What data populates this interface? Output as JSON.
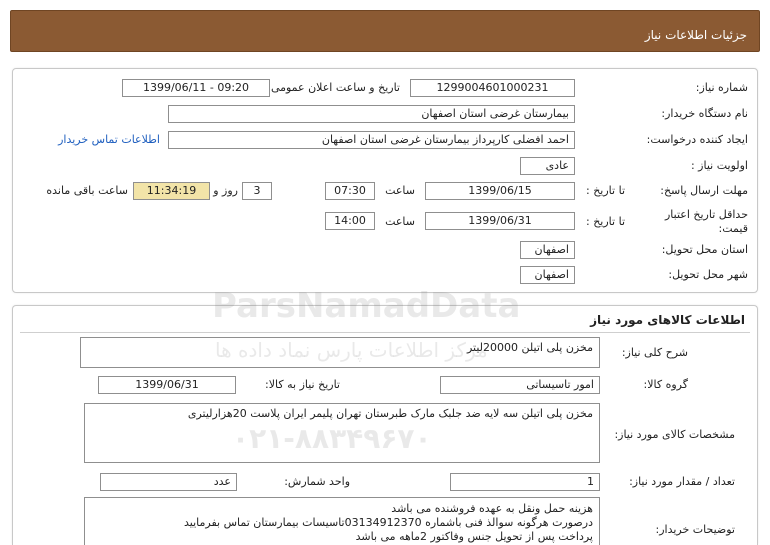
{
  "header": {
    "title": "جزئیات اطلاعات نیاز"
  },
  "need_info": {
    "need_number": {
      "label": "شماره نیاز:",
      "value": "1299004601000231"
    },
    "announce_datetime": {
      "label": "تاریخ و ساعت اعلان عمومی:",
      "value": "1399/06/11 - 09:20"
    },
    "buyer_org": {
      "label": "نام دستگاه خریدار:",
      "value": "بیمارستان غرضی استان اصفهان"
    },
    "requester": {
      "label": "ایجاد کننده درخواست:",
      "value": "احمد افضلی کارپرداز بیمارستان غرضی استان اصفهان"
    },
    "buyer_contact_link": "اطلاعات تماس خریدار",
    "priority": {
      "label": "اولویت نیاز :",
      "value": "عادی"
    },
    "response_deadline": {
      "label": "مهلت ارسال پاسخ:",
      "to_date_label": "تا تاریخ :",
      "date": "1399/06/15",
      "time_label": "ساعت",
      "time": "07:30",
      "days_left": "3",
      "days_label": "روز و",
      "time_left": "11:34:19",
      "time_left_label": "ساعت باقی مانده"
    },
    "price_validity": {
      "label_line1": "حداقل تاریخ اعتبار",
      "label_line2": "قیمت:",
      "to_date_label": "تا تاریخ :",
      "date": "1399/06/31",
      "time_label": "ساعت",
      "time": "14:00"
    },
    "delivery_province": {
      "label": "استان محل تحویل:",
      "value": "اصفهان"
    },
    "delivery_city": {
      "label": "شهر محل تحویل:",
      "value": "اصفهان"
    }
  },
  "goods_info": {
    "title": "اطلاعات کالاهای مورد نیاز",
    "general_description": {
      "label": "شرح کلی نیاز:",
      "value": "مخزن پلی اتیلن 20000لیتر"
    },
    "goods_group": {
      "label": "گروه کالا:",
      "value": "امور تاسیساتی"
    },
    "need_date": {
      "label": "تاریخ نیاز به کالا:",
      "value": "1399/06/31"
    },
    "specifications": {
      "label": "مشخصات کالای مورد نیاز:",
      "value": "مخزن پلی اتیلن سه لایه ضد جلبک مارک طبرستان تهران پلیمر ایران پلاست 20هزارلیتری"
    },
    "quantity": {
      "label": "تعداد / مقدار مورد نیاز:",
      "value": "1"
    },
    "unit": {
      "label": "واحد شمارش:",
      "value": "عدد"
    },
    "buyer_notes": {
      "label": "توضیحات خریدار:",
      "lines": [
        "هزینه حمل ونقل به عهده فروشنده می باشد",
        "درصورت هرگونه سوالذ فنی باشماره 03134912370تاسیسات بیمارستان تماس بفرمایید",
        "پرداخت پس از تحویل جنس وفاکتور 2ماهه می باشد"
      ]
    }
  },
  "watermark": {
    "brand": "ParsNamadData",
    "tagline": "مرکز اطلاعات پارس نماد داده ها",
    "phone": "۰۲۱-۸۸۳۴۹۶۷۰"
  },
  "colors": {
    "header_bg": "#8b5a33",
    "link": "#1f5fbf",
    "countdown_bg": "#f2e4a8"
  }
}
